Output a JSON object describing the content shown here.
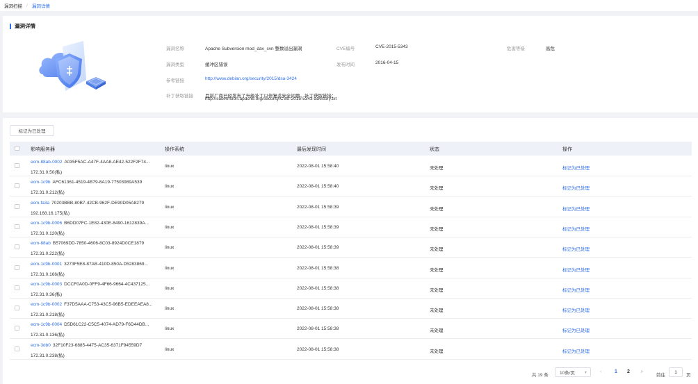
{
  "breadcrumb": {
    "parent": "漏洞扫描",
    "separator": "/",
    "current": "漏洞详情"
  },
  "detail": {
    "title": "漏洞详情",
    "labels": {
      "name": "漏洞名称",
      "type": "漏洞类型",
      "ref": "参考链接",
      "patch": "补丁获取链接",
      "cve": "CVE编号",
      "date": "发布时间",
      "severity": "危害等级"
    },
    "values": {
      "name": "Apache Subversion mod_dav_svn 整数溢出漏洞",
      "type": "缓冲区错误",
      "ref": "http://www.debian.org/security/2015/dsa-3424",
      "patch_line1": "目前厂商已经发布了升级补丁以修复此安全问题，补丁获取链接：",
      "patch_line2": "http://subversion.apache.org/security/CVE-2015-5343-advisory.txt",
      "cve": "CVE-2015-5343",
      "date": "2016-04-15",
      "severity": "高危"
    }
  },
  "toolbar": {
    "mark_button": "标记为已处理"
  },
  "table": {
    "columns": [
      "影响服务器",
      "操作系统",
      "最后发现时间",
      "状态",
      "操作"
    ],
    "rows": [
      {
        "name": "ecm-88ab-0002",
        "id": "A035F5AC-A47F-4AA8-AE42-522F2F74...",
        "ip": "172.31.0.50(私)",
        "os": "linux",
        "time": "2022-08-01 15:58:40",
        "status": "未处理",
        "action": "标记为已处理"
      },
      {
        "name": "ecm-1c9b",
        "id": "AFC61361-4519-4B79-8A19-77503989A539",
        "ip": "172.31.0.212(私)",
        "os": "linux",
        "time": "2022-08-01 15:58:40",
        "status": "未处理",
        "action": "标记为已处理"
      },
      {
        "name": "ecm-fa3a",
        "id": "70203BBB-80B7-42CB-962F-DE90D05A8279",
        "ip": "192.168.16.175(私)",
        "os": "linux",
        "time": "2022-08-01 15:58:39",
        "status": "未处理",
        "action": "标记为已处理"
      },
      {
        "name": "ecm-1c9b-0006",
        "id": "B6DD07FC-1E82-430E-8490-1612839A...",
        "ip": "172.31.0.120(私)",
        "os": "linux",
        "time": "2022-08-01 15:58:39",
        "status": "未处理",
        "action": "标记为已处理"
      },
      {
        "name": "ecm-88ab",
        "id": "B57069DD-7850-4606-8C03-8924D0CE1879",
        "ip": "172.31.0.222(私)",
        "os": "linux",
        "time": "2022-08-01 15:58:39",
        "status": "未处理",
        "action": "标记为已处理"
      },
      {
        "name": "ecm-1c9b-0001",
        "id": "3273F5E8-87AB-410D-850A-D5283869...",
        "ip": "172.31.0.166(私)",
        "os": "linux",
        "time": "2022-08-01 15:58:38",
        "status": "未处理",
        "action": "标记为已处理"
      },
      {
        "name": "ecm-1c9b-0003",
        "id": "DCCF0A0D-0FF9-4F66-9664-4C437125...",
        "ip": "172.31.0.36(私)",
        "os": "linux",
        "time": "2022-08-01 15:58:38",
        "status": "未处理",
        "action": "标记为已处理"
      },
      {
        "name": "ecm-1c9b-0002",
        "id": "F37D5AAA-C753-43C5-96B5-EDEEAEA8...",
        "ip": "172.31.0.218(私)",
        "os": "linux",
        "time": "2022-08-01 15:58:38",
        "status": "未处理",
        "action": "标记为已处理"
      },
      {
        "name": "ecm-1c9b-0004",
        "id": "D5D61C22-C5C5-4074-AD79-F6D44DB...",
        "ip": "172.31.0.136(私)",
        "os": "linux",
        "time": "2022-08-01 15:58:38",
        "status": "未处理",
        "action": "标记为已处理"
      },
      {
        "name": "ecm-3db0",
        "id": "32F10F23-6885-4475-AC35-6371F94559D7",
        "ip": "172.31.0.238(私)",
        "os": "linux",
        "time": "2022-08-01 15:58:38",
        "status": "未处理",
        "action": "标记为已处理"
      }
    ]
  },
  "pagination": {
    "total": "共 19 条",
    "page_size": "10条/页",
    "prev": "‹",
    "pages": [
      "1",
      "2"
    ],
    "current_page": "1",
    "next": "›",
    "goto_label": "前往",
    "goto_value": "1",
    "goto_suffix": "页"
  },
  "colors": {
    "accent": "#2f6fea",
    "header_bg": "#eef1f8"
  },
  "icons": {
    "illustration": "cloud-shield-illustration",
    "caret": "chevron-down-icon"
  }
}
